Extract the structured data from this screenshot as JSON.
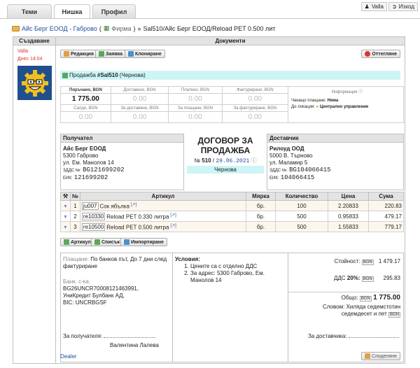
{
  "tabs": [
    {
      "label": "Теми"
    },
    {
      "label": "Нишка"
    },
    {
      "label": "Профил"
    }
  ],
  "topbar": {
    "user": "Valla",
    "logout": "Изход"
  },
  "breadcrumb": {
    "company": "Айс Берг ЕООД - Габрово",
    "company_type": "Фирма",
    "separator": "»",
    "current": "Sal510/Айс Берг ЕООД/Reload PET 0.500 лит"
  },
  "columns": {
    "left": "Създаване",
    "right": "Документи"
  },
  "left": {
    "user": "Valla",
    "time": "Днес 14:04"
  },
  "actions": {
    "edit": "Редакция",
    "request": "Заявка",
    "clone": "Клониране",
    "cancel": "Оттегляне"
  },
  "doc_title": {
    "prefix": "Продажба",
    "number": "#Sal510",
    "status": "(Чернова)"
  },
  "summary": {
    "labels_row1": [
      "Поръчано, BGN",
      "Доставено, BGN",
      "Платено, BGN",
      "Фактурирано, BGN"
    ],
    "values_row1": [
      "1 775.00",
      "0.00",
      "0.00",
      "0.00"
    ],
    "labels_row2": [
      "Салдо, BGN",
      "За доставяне, BGN",
      "За плащане, BGN",
      "За фактуриране, BGN"
    ],
    "values_row2": [
      "0.00",
      "0.00",
      "0.00",
      "0.00"
    ],
    "info_title": "Информация",
    "pending_label": "Чакащо плащане:",
    "pending_value": "Няма",
    "location_label": "До локация:",
    "location_value": "Централно управление"
  },
  "recipient": {
    "header": "Получател",
    "name": "Айс Берг ЕООД",
    "city": "5300 Габрово",
    "street": "ул. Ем. Манолов 14",
    "vat_label": "ЗДДС №:",
    "vat": "BG121699202",
    "eik_label": "ЕИК:",
    "eik": "121699202"
  },
  "contract": {
    "title": "ДОГОВОР ЗА ПРОДАЖБА",
    "no_label": "№",
    "number": "510",
    "slash": "/",
    "date": "29.06.2021",
    "status": "Чернова"
  },
  "supplier": {
    "header": "Доставчик",
    "name": "Рилоуд ООД",
    "city": "5000 В. Търново",
    "street": "ул. Маламир 5",
    "vat_label": "ЗДДС №:",
    "vat": "BG104066415",
    "eik_label": "ЕИК:",
    "eik": "104066415"
  },
  "items_table": {
    "headers": [
      "№",
      "Артикул",
      "Мярка",
      "Количество",
      "Цена",
      "Сума"
    ],
    "rows": [
      {
        "no": "1",
        "code": "ju007",
        "name": "Сок ябълка",
        "unit": "бр.",
        "qty": "100",
        "price": "2.20833",
        "sum": "220.83"
      },
      {
        "no": "2",
        "code": "re10330",
        "name": "Reload PET 0.330 литра",
        "unit": "бр.",
        "qty": "500",
        "price": "0.95833",
        "sum": "479.17"
      },
      {
        "no": "3",
        "code": "re10500",
        "name": "Reload PET 0.500 литра",
        "unit": "бр.",
        "qty": "500",
        "price": "1.55833",
        "sum": "779.17"
      }
    ]
  },
  "item_buttons": {
    "article": "Артикул",
    "lists": "Списък",
    "import": "Импортиране"
  },
  "payment": {
    "label": "Плащане:",
    "value": "По банков път, До 7 дни след фактуриране",
    "bank_label": "Банк. с-ка:",
    "iban": "BG26UNCR70008121463991,",
    "bank": "УниКредит Булбанк АД,",
    "bic": "BIC: UNCRBGSF"
  },
  "conditions": {
    "title": "Условия:",
    "items": [
      "Цените са с отделно ДДС",
      "За адрес: 5300 Габрово, Ем. Манолов 14"
    ]
  },
  "totals": {
    "value_label": "Стойност:",
    "currency": "BGN",
    "value": "1 479.17",
    "vat_label": "ДДС",
    "vat_rate": "20%:",
    "vat_value": "295.83",
    "total_label": "Общо:",
    "total_value": "1 775.00",
    "words_label": "Словом:",
    "words": "Хиляда седемстотин седемдесет и пет"
  },
  "signatures": {
    "recipient_label": "За получателя:",
    "recipient_name": "Валентина Лалева",
    "supplier_label": "За доставчика:"
  },
  "dealer": "Dealer",
  "share": "Споделяне"
}
